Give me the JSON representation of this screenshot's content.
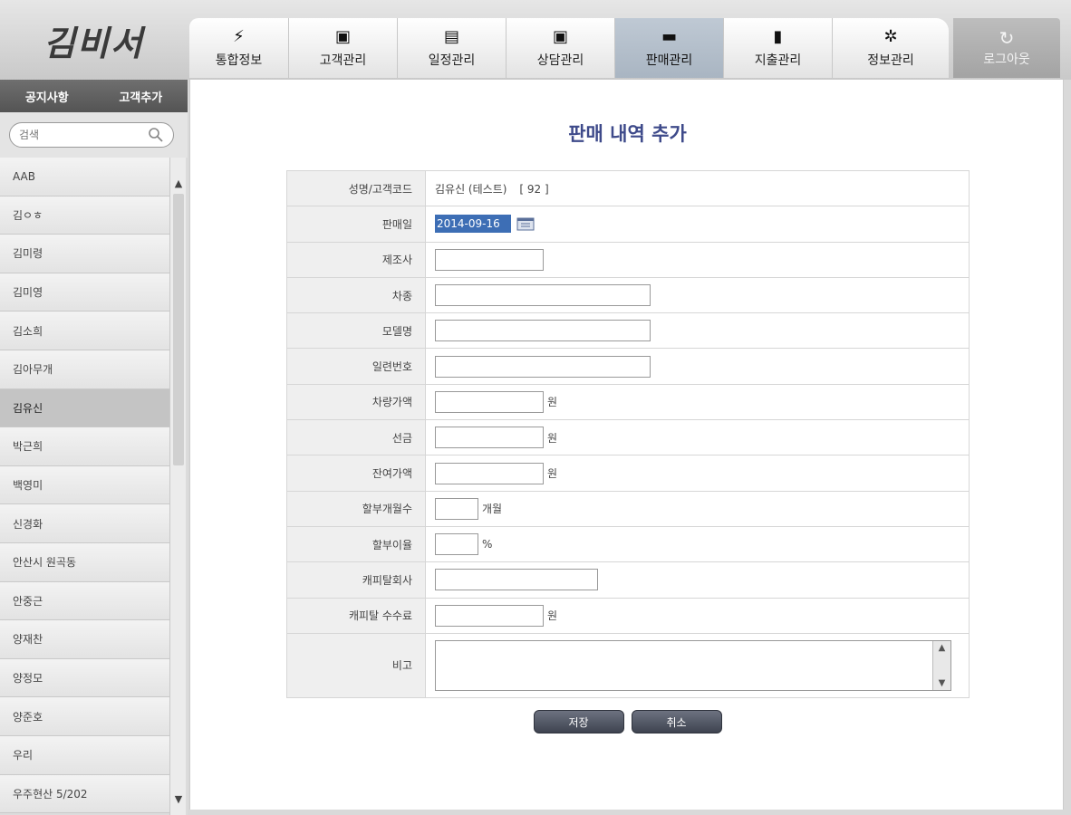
{
  "app": {
    "logo_text": "김비서"
  },
  "nav": {
    "tabs": [
      {
        "label": "통합정보",
        "icon": "bolt-icon",
        "glyph": "⚡"
      },
      {
        "label": "고객관리",
        "icon": "customer-folder-icon",
        "glyph": "▣"
      },
      {
        "label": "일정관리",
        "icon": "schedule-folder-icon",
        "glyph": "▤"
      },
      {
        "label": "상담관리",
        "icon": "consult-folder-icon",
        "glyph": "▣"
      },
      {
        "label": "판매관리",
        "icon": "briefcase-icon",
        "glyph": "▬"
      },
      {
        "label": "지출관리",
        "icon": "document-icon",
        "glyph": "▮"
      },
      {
        "label": "정보관리",
        "icon": "gear-icon",
        "glyph": "✲"
      }
    ],
    "active_index": 4,
    "logout_label": "로그아웃",
    "logout_glyph": "↻"
  },
  "sidebar": {
    "notice_label": "공지사항",
    "add_customer_label": "고객추가",
    "search_placeholder": "검색",
    "customers": [
      "AAB",
      "김ㅇㅎ",
      "김미령",
      "김미영",
      "김소희",
      "김아무개",
      "김유신",
      "박근희",
      "백영미",
      "신경화",
      "안산시 원곡동",
      "안중근",
      "양재찬",
      "양정모",
      "양준호",
      "우리",
      "우주현산 5/202"
    ],
    "selected_index": 6
  },
  "form": {
    "title": "판매 내역 추가",
    "rows": {
      "customer": {
        "label": "성명/고객코드",
        "name": "김유신 (테스트)",
        "code": "[ 92 ]"
      },
      "sale_date": {
        "label": "판매일",
        "value": "2014-09-16"
      },
      "maker": {
        "label": "제조사",
        "value": ""
      },
      "car_type": {
        "label": "차종",
        "value": ""
      },
      "model": {
        "label": "모델명",
        "value": ""
      },
      "serial": {
        "label": "일련번호",
        "value": ""
      },
      "car_price": {
        "label": "차량가액",
        "value": "",
        "unit": "원"
      },
      "deposit": {
        "label": "선금",
        "value": "",
        "unit": "원"
      },
      "remain": {
        "label": "잔여가액",
        "value": "",
        "unit": "원"
      },
      "months": {
        "label": "할부개월수",
        "value": "",
        "unit": "개월"
      },
      "rate": {
        "label": "할부이율",
        "value": "",
        "unit": "%"
      },
      "capital": {
        "label": "캐피탈회사",
        "value": ""
      },
      "capital_fee": {
        "label": "캐피탈 수수료",
        "value": "",
        "unit": "원"
      },
      "memo": {
        "label": "비고",
        "value": ""
      }
    },
    "save_label": "저장",
    "cancel_label": "취소"
  },
  "colors": {
    "title": "#3e4a8a",
    "active_tab": "#b4bfcc",
    "button": "#4a4f5c",
    "date_highlight": "#3d6eb5"
  }
}
